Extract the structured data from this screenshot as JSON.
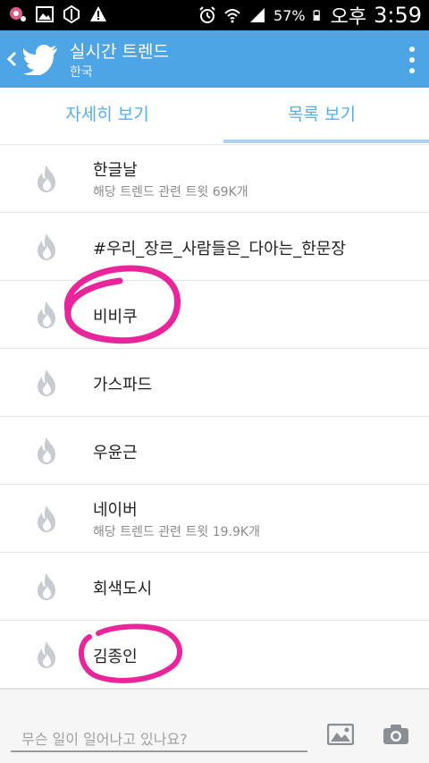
{
  "status_bar": {
    "battery_percent": "57%",
    "ampm": "오후",
    "time": "3:59",
    "icons": [
      "notification-badge-icon",
      "image-icon",
      "exo-logo-icon",
      "warning-icon",
      "alarm-icon",
      "wifi-icon",
      "signal-icon",
      "battery-icon"
    ]
  },
  "app_bar": {
    "title": "실시간 트렌드",
    "subtitle": "한국",
    "icons": [
      "back-chevron-icon",
      "twitter-bird-icon",
      "overflow-menu-icon"
    ],
    "color": "#4ea5e6"
  },
  "tabs": [
    {
      "label": "자세히 보기",
      "selected": false
    },
    {
      "label": "목록 보기",
      "selected": true
    }
  ],
  "trends": [
    {
      "name": "한글날",
      "meta": "해당 트렌드 관련 트윗 69K개"
    },
    {
      "name": "#우리_장르_사람들은_다아는_한문장",
      "meta": ""
    },
    {
      "name": "비비쿠",
      "meta": ""
    },
    {
      "name": "가스파드",
      "meta": ""
    },
    {
      "name": "우윤근",
      "meta": ""
    },
    {
      "name": "네이버",
      "meta": "해당 트렌드 관련 트윗 19.9K개"
    },
    {
      "name": "회색도시",
      "meta": ""
    },
    {
      "name": "김종인",
      "meta": ""
    }
  ],
  "compose": {
    "placeholder": "무슨 일이 일어나고 있나요?",
    "icons": [
      "photo-icon",
      "camera-icon"
    ]
  },
  "annotation_color": "#e8259b"
}
